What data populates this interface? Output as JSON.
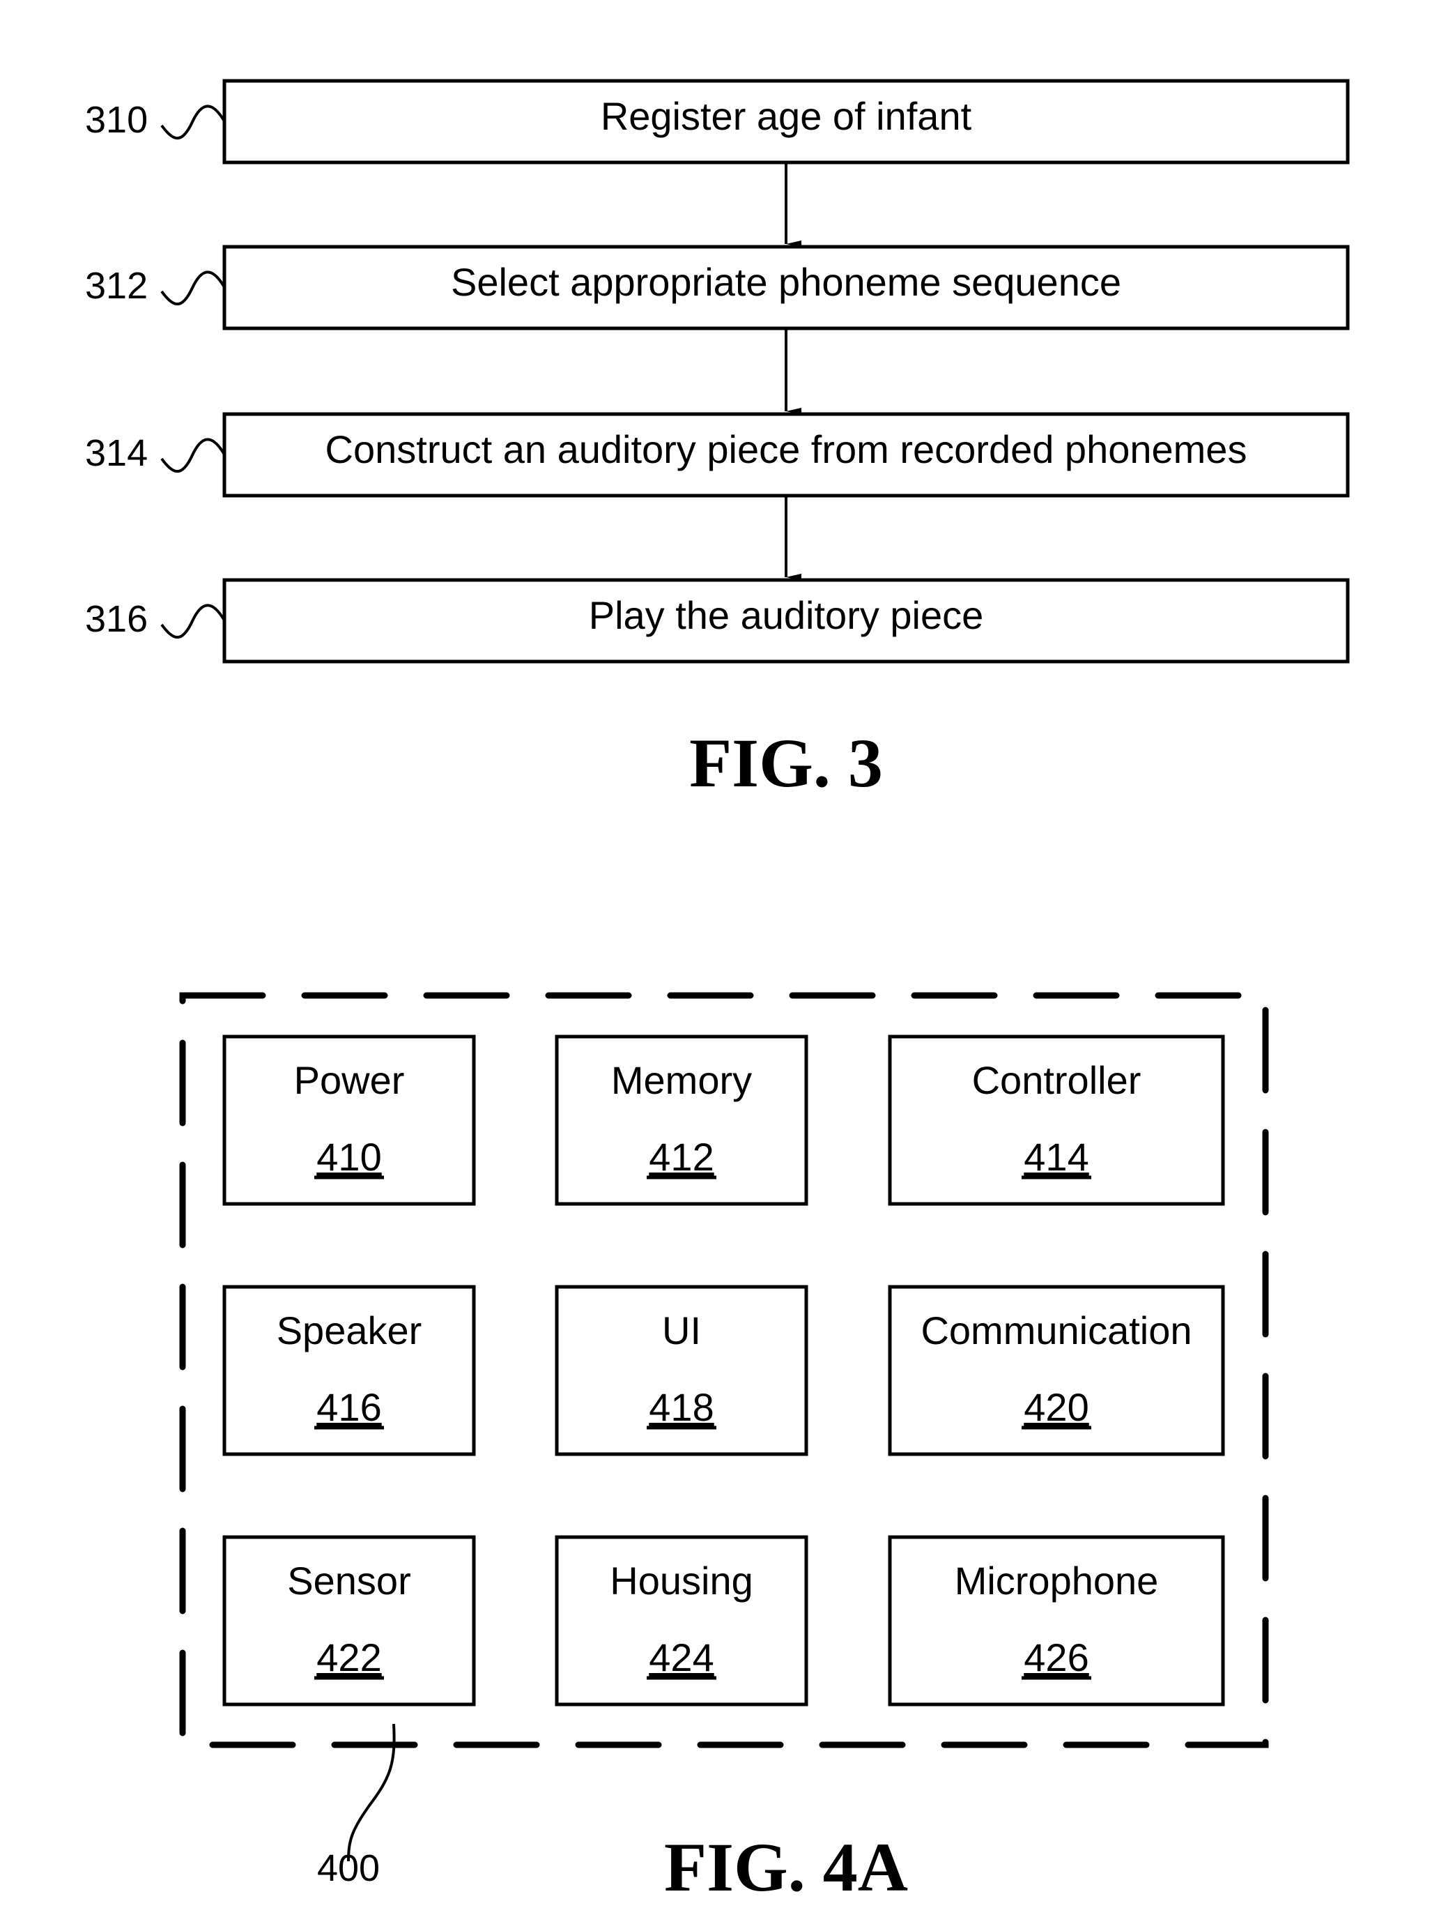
{
  "fig3": {
    "caption": "FIG. 3",
    "steps": [
      {
        "ref": "310",
        "label": "Register age of infant"
      },
      {
        "ref": "312",
        "label": "Select appropriate phoneme sequence"
      },
      {
        "ref": "314",
        "label": "Construct an auditory piece from recorded phonemes"
      },
      {
        "ref": "316",
        "label": "Play the auditory piece"
      }
    ]
  },
  "fig4a": {
    "caption": "FIG. 4A",
    "container_ref": "400",
    "components": [
      {
        "name": "Power",
        "ref": "410"
      },
      {
        "name": "Memory",
        "ref": "412"
      },
      {
        "name": "Controller",
        "ref": "414"
      },
      {
        "name": "Speaker",
        "ref": "416"
      },
      {
        "name": "UI",
        "ref": "418"
      },
      {
        "name": "Communication",
        "ref": "420"
      },
      {
        "name": "Sensor",
        "ref": "422"
      },
      {
        "name": "Housing",
        "ref": "424"
      },
      {
        "name": "Microphone",
        "ref": "426"
      }
    ]
  }
}
